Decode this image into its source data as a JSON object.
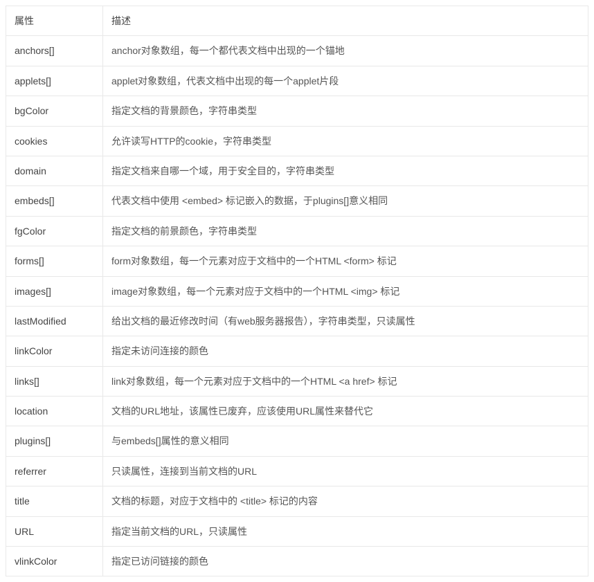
{
  "headers": {
    "attr": "属性",
    "desc": "描述"
  },
  "rows": [
    {
      "attr": "anchors[]",
      "desc": "anchor对象数组，每一个都代表文档中出现的一个锚地"
    },
    {
      "attr": "applets[]",
      "desc": "applet对象数组，代表文档中出现的每一个applet片段"
    },
    {
      "attr": "bgColor",
      "desc": "指定文档的背景颜色，字符串类型"
    },
    {
      "attr": "cookies",
      "desc": "允许读写HTTP的cookie，字符串类型"
    },
    {
      "attr": "domain",
      "desc": "指定文档来自哪一个域，用于安全目的，字符串类型"
    },
    {
      "attr": "embeds[]",
      "desc": "代表文档中使用 <embed> 标记嵌入的数据，于plugins[]意义相同"
    },
    {
      "attr": "fgColor",
      "desc": "指定文档的前景颜色，字符串类型"
    },
    {
      "attr": "forms[]",
      "desc": "form对象数组，每一个元素对应于文档中的一个HTML  <form> 标记"
    },
    {
      "attr": "images[]",
      "desc": "image对象数组，每一个元素对应于文档中的一个HTML <img> 标记"
    },
    {
      "attr": "lastModified",
      "desc": "给出文档的最近修改时间（有web服务器报告），字符串类型，只读属性"
    },
    {
      "attr": "linkColor",
      "desc": "指定未访问连接的颜色"
    },
    {
      "attr": "links[]",
      "desc": "link对象数组，每一个元素对应于文档中的一个HTML  <a href> 标记"
    },
    {
      "attr": "location",
      "desc": "文档的URL地址，该属性已废弃，应该使用URL属性来替代它"
    },
    {
      "attr": "plugins[]",
      "desc": "与embeds[]属性的意义相同"
    },
    {
      "attr": "referrer",
      "desc": "只读属性，连接到当前文档的URL"
    },
    {
      "attr": "title",
      "desc": "文档的标题，对应于文档中的 <title> 标记的内容"
    },
    {
      "attr": "URL",
      "desc": "指定当前文档的URL，只读属性"
    },
    {
      "attr": "vlinkColor",
      "desc": "指定已访问链接的颜色"
    }
  ]
}
